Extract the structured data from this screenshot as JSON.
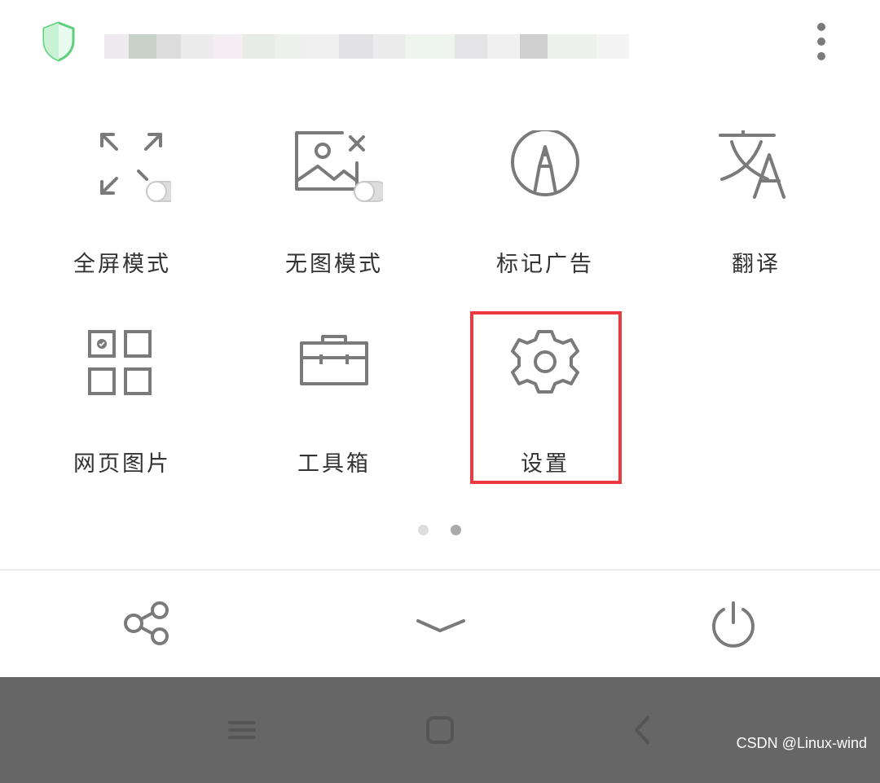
{
  "header": {
    "shield_icon": "shield-icon",
    "url_text": "",
    "menu_icon": "more-vertical-icon",
    "shield_color": "#5cd07a"
  },
  "grid": [
    {
      "label": "全屏模式",
      "icon": "fullscreen-toggle-icon"
    },
    {
      "label": "无图模式",
      "icon": "no-image-toggle-icon"
    },
    {
      "label": "标记广告",
      "icon": "mark-ad-icon"
    },
    {
      "label": "翻译",
      "icon": "translate-icon"
    },
    {
      "label": "网页图片",
      "icon": "page-images-icon"
    },
    {
      "label": "工具箱",
      "icon": "toolbox-icon"
    },
    {
      "label": "设置",
      "icon": "settings-icon"
    }
  ],
  "page_indicator": {
    "count": 2,
    "active": 1
  },
  "bottom_actions": [
    {
      "name": "share",
      "icon": "share-icon"
    },
    {
      "name": "collapse",
      "icon": "chevron-down-icon"
    },
    {
      "name": "exit",
      "icon": "power-icon"
    }
  ],
  "nav": [
    {
      "name": "menu",
      "icon": "menu-icon"
    },
    {
      "name": "home",
      "icon": "home-icon"
    },
    {
      "name": "back",
      "icon": "back-icon"
    }
  ],
  "watermark": "CSDN @Linux-wind",
  "colors": {
    "icon": "#7a7a7a",
    "highlight": "#ee3a3f",
    "nav_bg": "#666666"
  }
}
